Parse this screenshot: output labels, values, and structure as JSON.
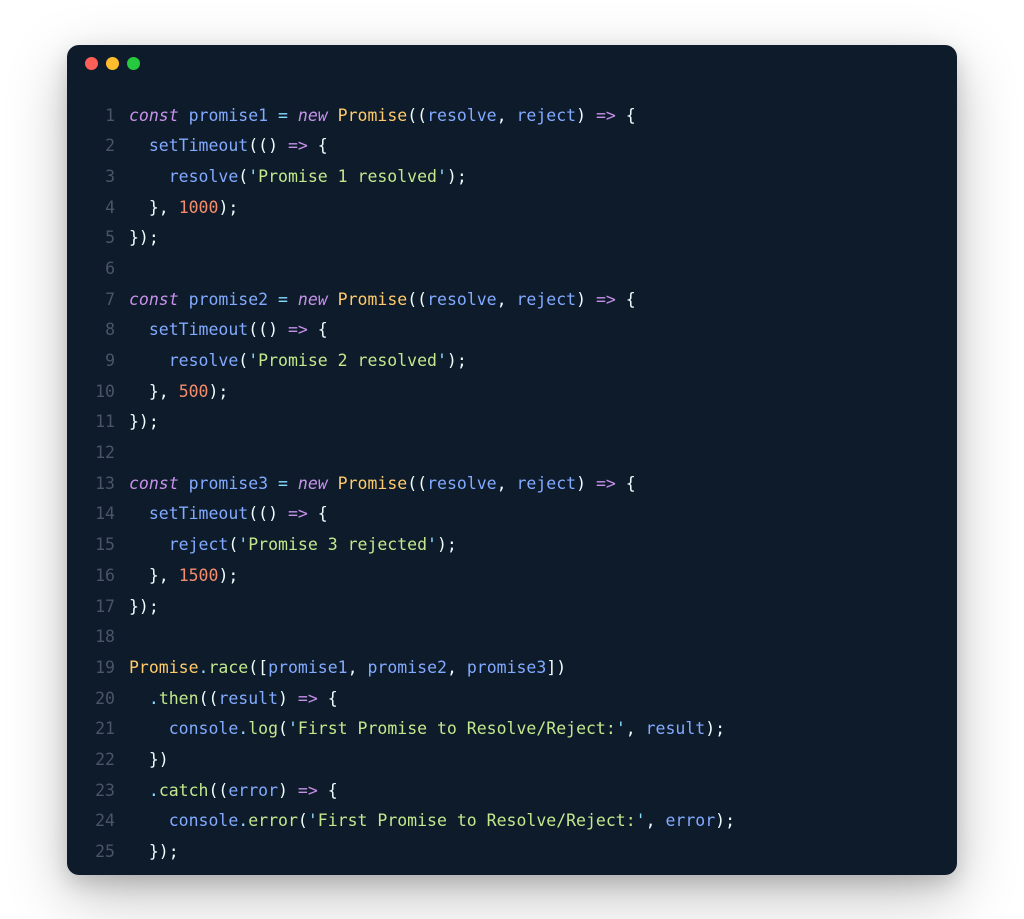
{
  "window": {
    "traffic_lights": [
      "close",
      "minimize",
      "maximize"
    ]
  },
  "theme": {
    "background": "#0d1b2a",
    "keyword": "#c792ea",
    "identifier": "#82aaff",
    "class": "#ffcb6b",
    "method": "#c3e88d",
    "operator": "#89ddff",
    "string": "#c3e88d",
    "number": "#f78c6c",
    "linenum": "#4a5568"
  },
  "code": {
    "language": "javascript",
    "lines": [
      {
        "n": "1",
        "tokens": [
          [
            "kw-decl",
            "const"
          ],
          [
            "",
            ""
          ],
          [
            "ident",
            "promise1"
          ],
          [
            "",
            ""
          ],
          [
            "op",
            "="
          ],
          [
            "",
            ""
          ],
          [
            "kw-decl",
            "new"
          ],
          [
            "",
            ""
          ],
          [
            "cls",
            "Promise"
          ],
          [
            "punc",
            "(("
          ],
          [
            "ident",
            "resolve"
          ],
          [
            "punc",
            ", "
          ],
          [
            "ident",
            "reject"
          ],
          [
            "punc",
            ") "
          ],
          [
            "arrow",
            "=>"
          ],
          [
            "punc",
            " {"
          ]
        ]
      },
      {
        "n": "2",
        "tokens": [
          [
            "",
            "  "
          ],
          [
            "fn",
            "setTimeout"
          ],
          [
            "punc",
            "(() "
          ],
          [
            "arrow",
            "=>"
          ],
          [
            "punc",
            " {"
          ]
        ]
      },
      {
        "n": "3",
        "tokens": [
          [
            "",
            "    "
          ],
          [
            "fn",
            "resolve"
          ],
          [
            "punc",
            "("
          ],
          [
            "strq",
            "'"
          ],
          [
            "str",
            "Promise 1 resolved"
          ],
          [
            "strq",
            "'"
          ],
          [
            "punc",
            ");"
          ]
        ]
      },
      {
        "n": "4",
        "tokens": [
          [
            "",
            "  "
          ],
          [
            "punc",
            "}, "
          ],
          [
            "num",
            "1000"
          ],
          [
            "punc",
            ");"
          ]
        ]
      },
      {
        "n": "5",
        "tokens": [
          [
            "punc",
            "});"
          ]
        ]
      },
      {
        "n": "6",
        "tokens": [
          [
            "",
            ""
          ]
        ]
      },
      {
        "n": "7",
        "tokens": [
          [
            "kw-decl",
            "const"
          ],
          [
            "",
            ""
          ],
          [
            "ident",
            "promise2"
          ],
          [
            "",
            ""
          ],
          [
            "op",
            "="
          ],
          [
            "",
            ""
          ],
          [
            "kw-decl",
            "new"
          ],
          [
            "",
            ""
          ],
          [
            "cls",
            "Promise"
          ],
          [
            "punc",
            "(("
          ],
          [
            "ident",
            "resolve"
          ],
          [
            "punc",
            ", "
          ],
          [
            "ident",
            "reject"
          ],
          [
            "punc",
            ") "
          ],
          [
            "arrow",
            "=>"
          ],
          [
            "punc",
            " {"
          ]
        ]
      },
      {
        "n": "8",
        "tokens": [
          [
            "",
            "  "
          ],
          [
            "fn",
            "setTimeout"
          ],
          [
            "punc",
            "(() "
          ],
          [
            "arrow",
            "=>"
          ],
          [
            "punc",
            " {"
          ]
        ]
      },
      {
        "n": "9",
        "tokens": [
          [
            "",
            "    "
          ],
          [
            "fn",
            "resolve"
          ],
          [
            "punc",
            "("
          ],
          [
            "strq",
            "'"
          ],
          [
            "str",
            "Promise 2 resolved"
          ],
          [
            "strq",
            "'"
          ],
          [
            "punc",
            ");"
          ]
        ]
      },
      {
        "n": "10",
        "tokens": [
          [
            "",
            "  "
          ],
          [
            "punc",
            "}, "
          ],
          [
            "num",
            "500"
          ],
          [
            "punc",
            ");"
          ]
        ]
      },
      {
        "n": "11",
        "tokens": [
          [
            "punc",
            "});"
          ]
        ]
      },
      {
        "n": "12",
        "tokens": [
          [
            "",
            ""
          ]
        ]
      },
      {
        "n": "13",
        "tokens": [
          [
            "kw-decl",
            "const"
          ],
          [
            "",
            ""
          ],
          [
            "ident",
            "promise3"
          ],
          [
            "",
            ""
          ],
          [
            "op",
            "="
          ],
          [
            "",
            ""
          ],
          [
            "kw-decl",
            "new"
          ],
          [
            "",
            ""
          ],
          [
            "cls",
            "Promise"
          ],
          [
            "punc",
            "(("
          ],
          [
            "ident",
            "resolve"
          ],
          [
            "punc",
            ", "
          ],
          [
            "ident",
            "reject"
          ],
          [
            "punc",
            ") "
          ],
          [
            "arrow",
            "=>"
          ],
          [
            "punc",
            " {"
          ]
        ]
      },
      {
        "n": "14",
        "tokens": [
          [
            "",
            "  "
          ],
          [
            "fn",
            "setTimeout"
          ],
          [
            "punc",
            "(() "
          ],
          [
            "arrow",
            "=>"
          ],
          [
            "punc",
            " {"
          ]
        ]
      },
      {
        "n": "15",
        "tokens": [
          [
            "",
            "    "
          ],
          [
            "fn",
            "reject"
          ],
          [
            "punc",
            "("
          ],
          [
            "strq",
            "'"
          ],
          [
            "str",
            "Promise 3 rejected"
          ],
          [
            "strq",
            "'"
          ],
          [
            "punc",
            ");"
          ]
        ]
      },
      {
        "n": "16",
        "tokens": [
          [
            "",
            "  "
          ],
          [
            "punc",
            "}, "
          ],
          [
            "num",
            "1500"
          ],
          [
            "punc",
            ");"
          ]
        ]
      },
      {
        "n": "17",
        "tokens": [
          [
            "punc",
            "});"
          ]
        ]
      },
      {
        "n": "18",
        "tokens": [
          [
            "",
            ""
          ]
        ]
      },
      {
        "n": "19",
        "tokens": [
          [
            "cls",
            "Promise"
          ],
          [
            "dot-op",
            "."
          ],
          [
            "method",
            "race"
          ],
          [
            "punc",
            "(["
          ],
          [
            "ident",
            "promise1"
          ],
          [
            "punc",
            ", "
          ],
          [
            "ident",
            "promise2"
          ],
          [
            "punc",
            ", "
          ],
          [
            "ident",
            "promise3"
          ],
          [
            "punc",
            "])"
          ]
        ]
      },
      {
        "n": "20",
        "tokens": [
          [
            "",
            "  "
          ],
          [
            "dot-op",
            "."
          ],
          [
            "method",
            "then"
          ],
          [
            "punc",
            "(("
          ],
          [
            "ident",
            "result"
          ],
          [
            "punc",
            ") "
          ],
          [
            "arrow",
            "=>"
          ],
          [
            "punc",
            " {"
          ]
        ]
      },
      {
        "n": "21",
        "tokens": [
          [
            "",
            "    "
          ],
          [
            "ident",
            "console"
          ],
          [
            "dot-op",
            "."
          ],
          [
            "method",
            "log"
          ],
          [
            "punc",
            "("
          ],
          [
            "strq",
            "'"
          ],
          [
            "str",
            "First Promise to Resolve/Reject:"
          ],
          [
            "strq",
            "'"
          ],
          [
            "punc",
            ", "
          ],
          [
            "ident",
            "result"
          ],
          [
            "punc",
            ");"
          ]
        ]
      },
      {
        "n": "22",
        "tokens": [
          [
            "",
            "  "
          ],
          [
            "punc",
            "})"
          ]
        ]
      },
      {
        "n": "23",
        "tokens": [
          [
            "",
            "  "
          ],
          [
            "dot-op",
            "."
          ],
          [
            "method",
            "catch"
          ],
          [
            "punc",
            "(("
          ],
          [
            "ident",
            "error"
          ],
          [
            "punc",
            ") "
          ],
          [
            "arrow",
            "=>"
          ],
          [
            "punc",
            " {"
          ]
        ]
      },
      {
        "n": "24",
        "tokens": [
          [
            "",
            "    "
          ],
          [
            "ident",
            "console"
          ],
          [
            "dot-op",
            "."
          ],
          [
            "method",
            "error"
          ],
          [
            "punc",
            "("
          ],
          [
            "strq",
            "'"
          ],
          [
            "str",
            "First Promise to Resolve/Reject:"
          ],
          [
            "strq",
            "'"
          ],
          [
            "punc",
            ", "
          ],
          [
            "ident",
            "error"
          ],
          [
            "punc",
            ");"
          ]
        ]
      },
      {
        "n": "25",
        "tokens": [
          [
            "",
            "  "
          ],
          [
            "punc",
            "});"
          ]
        ]
      }
    ]
  }
}
